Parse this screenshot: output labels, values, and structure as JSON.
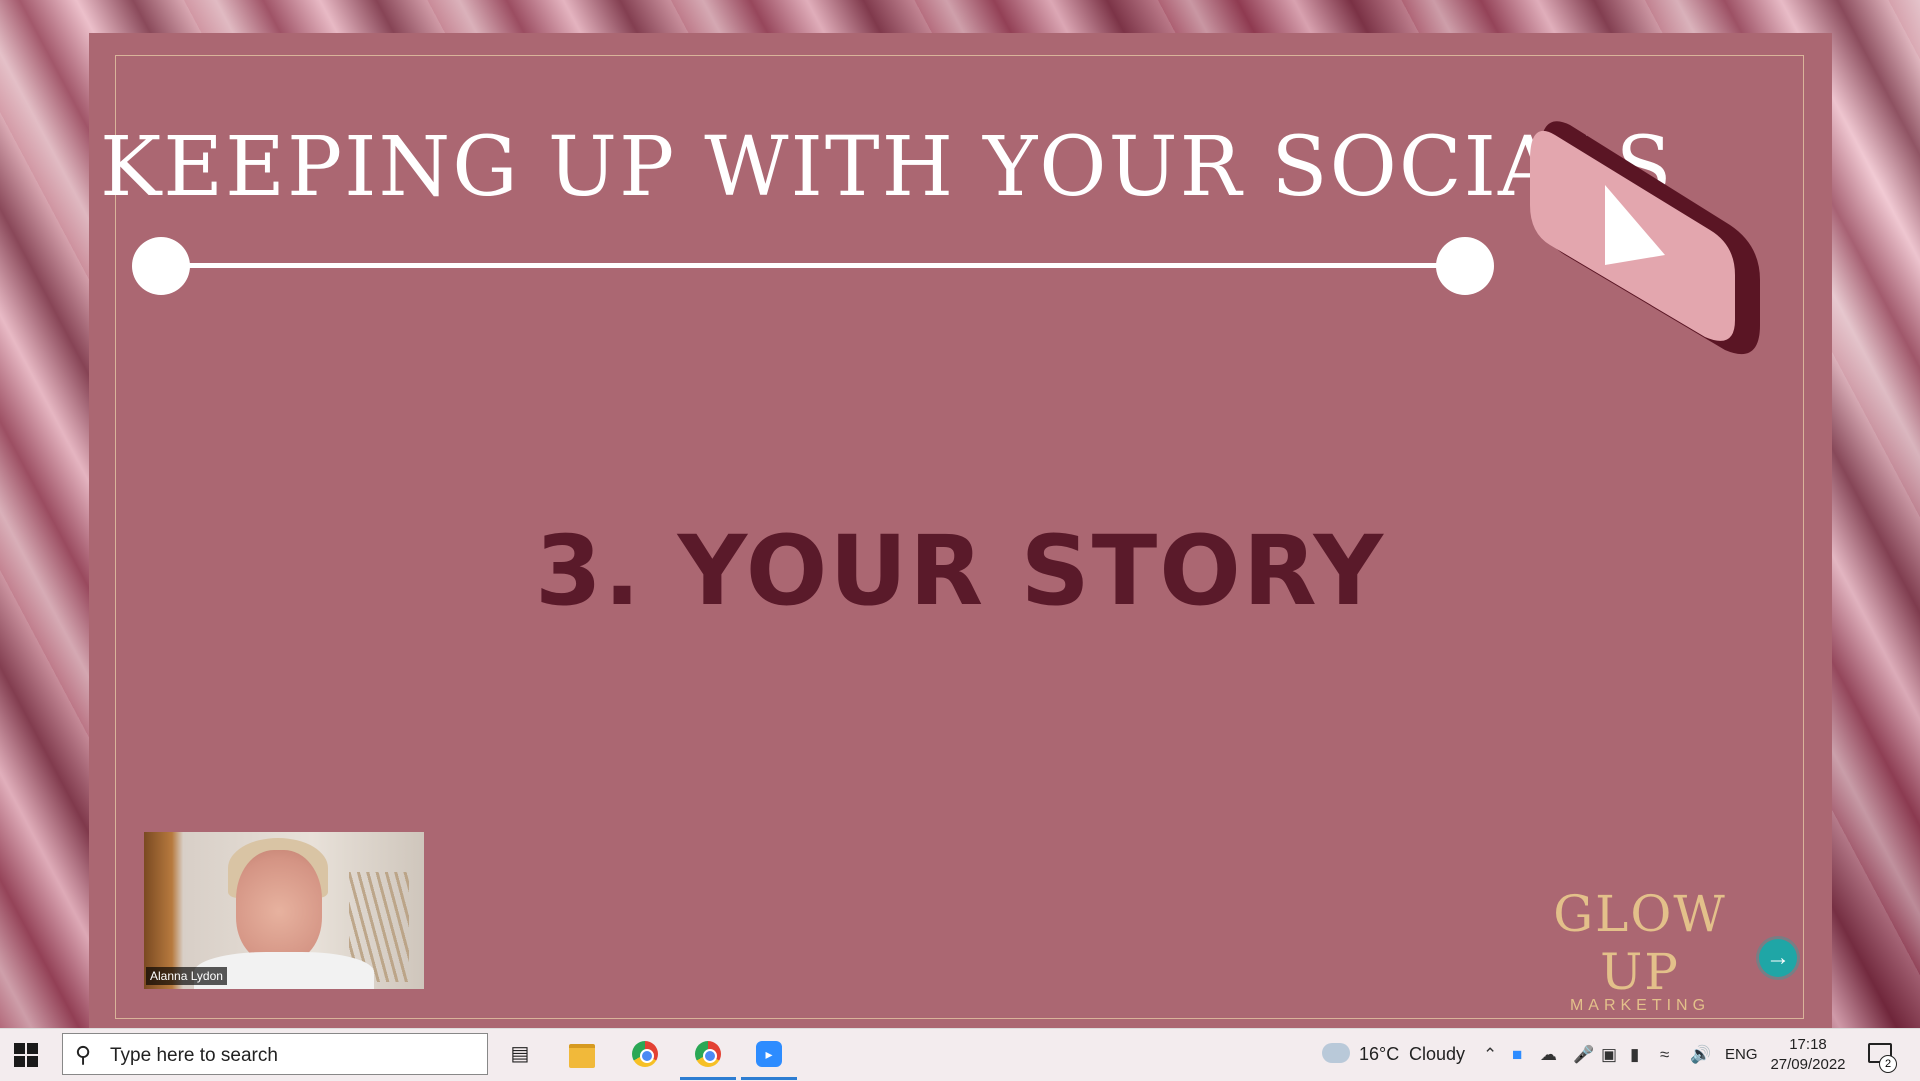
{
  "slide": {
    "title": "KEEPING UP WITH YOUR SOCIALS",
    "heading": "3. YOUR STORY",
    "logo_line1": "GLOW UP",
    "logo_line2": "MARKETING",
    "icon": "youtube-play-icon"
  },
  "video": {
    "participant_name": "Alanna Lydon"
  },
  "next_button": {
    "icon": "arrow-right-icon",
    "glyph": "→"
  },
  "taskbar": {
    "search_placeholder": "Type here to search",
    "search_icon": "search-icon",
    "apps": [
      "task-view-icon",
      "file-explorer-icon",
      "chrome-icon",
      "chrome-icon",
      "zoom-icon"
    ],
    "weather_temp": "16°C",
    "weather_text": "Cloudy",
    "language": "ENG",
    "time": "17:18",
    "date": "27/09/2022",
    "notification_count": "2"
  },
  "colors": {
    "slide_bg": "#ab6772",
    "heading": "#5a1a2a",
    "logo": "#e3c08a",
    "accent_button": "#1fa6a6"
  }
}
